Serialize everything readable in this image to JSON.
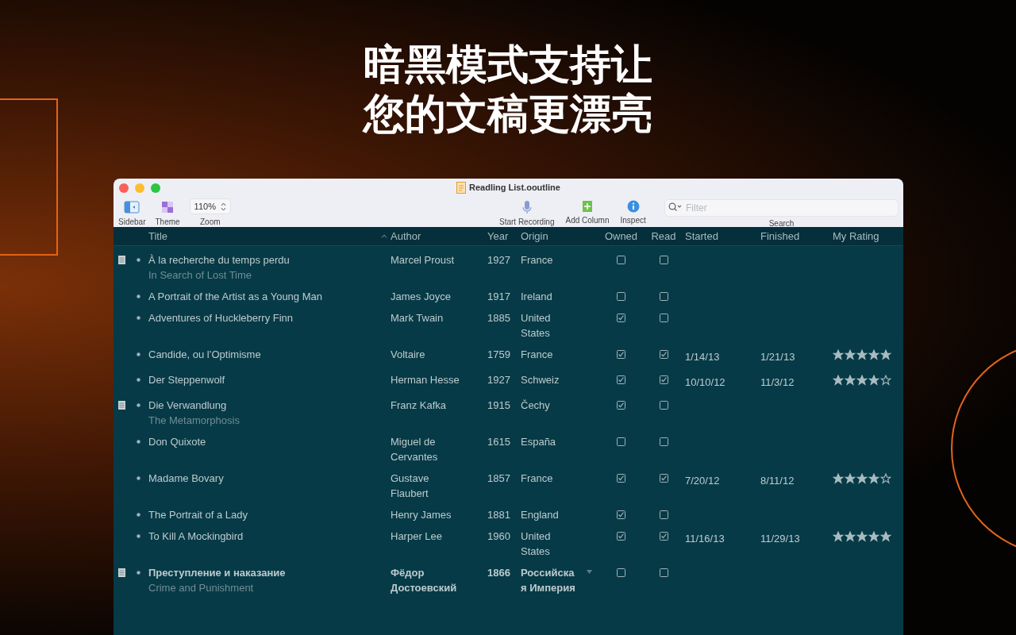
{
  "headline": [
    "暗黑模式支持让",
    "您的文稿更漂亮"
  ],
  "window": {
    "title": "Readling List.ooutline"
  },
  "toolbar": {
    "left": [
      {
        "kind": "sidebar",
        "label": "Sidebar"
      },
      {
        "kind": "theme",
        "label": "Theme"
      },
      {
        "kind": "zoom",
        "value": "110%",
        "label": "Zoom"
      }
    ],
    "right": [
      {
        "kind": "mic",
        "label": "Start Recording"
      },
      {
        "kind": "add-column",
        "label": "Add Column"
      },
      {
        "kind": "inspect",
        "label": "Inspect"
      }
    ],
    "search": {
      "placeholder": "Filter",
      "label": "Search"
    }
  },
  "table": {
    "columns": [
      {
        "label": "Title",
        "sorted": true
      },
      {
        "label": "Author",
        "sorted": false
      },
      {
        "label": "Year",
        "sorted": false
      },
      {
        "label": "Origin",
        "sorted": false
      },
      {
        "label": "Owned",
        "sorted": false
      },
      {
        "label": "Read",
        "sorted": false
      },
      {
        "label": "Started",
        "sorted": false
      },
      {
        "label": "Finished",
        "sorted": false
      },
      {
        "label": "My Rating",
        "sorted": false
      }
    ],
    "rows": [
      {
        "has_note": true,
        "bold": false,
        "title": "À la recherche du temps perdu",
        "subtitle": "In Search of Lost Time",
        "author": "Marcel Proust",
        "year": "1927",
        "origin": "France",
        "owned": false,
        "read": false
      },
      {
        "has_note": false,
        "bold": false,
        "title": "A Portrait of the Artist as a Young Man",
        "author": "James Joyce",
        "year": "1917",
        "origin": "Ireland",
        "owned": false,
        "read": false
      },
      {
        "has_note": false,
        "bold": false,
        "title": "Adventures of Huckleberry Finn",
        "author": "Mark Twain",
        "year": "1885",
        "origin": "United States",
        "owned": true,
        "read": false
      },
      {
        "has_note": false,
        "bold": false,
        "title": "Candide, ou l’Optimisme",
        "author": "Voltaire",
        "year": "1759",
        "origin": "France",
        "owned": true,
        "read": true,
        "started": "1/14/13",
        "finished": "1/21/13",
        "stars": 5
      },
      {
        "has_note": false,
        "bold": false,
        "title": "Der Steppenwolf",
        "author": "Herman Hesse",
        "year": "1927",
        "origin": "Schweiz",
        "owned": true,
        "read": true,
        "started": "10/10/12",
        "finished": "11/3/12",
        "stars": 4
      },
      {
        "has_note": true,
        "bold": false,
        "title": "Die Verwandlung",
        "subtitle": "The Metamorphosis",
        "author": "Franz Kafka",
        "year": "1915",
        "origin": "Čechy",
        "owned": true,
        "read": false
      },
      {
        "has_note": false,
        "bold": false,
        "title": "Don Quixote",
        "author": "Miguel de Cervantes",
        "year": "1615",
        "origin": "España",
        "owned": false,
        "read": false
      },
      {
        "has_note": false,
        "bold": false,
        "title": "Madame Bovary",
        "author": "Gustave Flaubert",
        "year": "1857",
        "origin": "France",
        "owned": true,
        "read": true,
        "started": "7/20/12",
        "finished": "8/11/12",
        "stars": 4
      },
      {
        "has_note": false,
        "bold": false,
        "title": "The Portrait of a Lady",
        "author": "Henry James",
        "year": "1881",
        "origin": "England",
        "owned": true,
        "read": false
      },
      {
        "has_note": false,
        "bold": false,
        "title": "To Kill A Mockingbird",
        "author": "Harper Lee",
        "year": "1960",
        "origin": "United States",
        "owned": true,
        "read": true,
        "started": "11/16/13",
        "finished": "11/29/13",
        "stars": 5
      },
      {
        "has_note": true,
        "bold": true,
        "title": "Преступление и наказание",
        "subtitle": "Crime and Punishment",
        "author": "Фёдор Достоевский",
        "year": "1866",
        "origin": "Российская Империя",
        "origin_menu": true,
        "owned": false,
        "read": false
      }
    ]
  }
}
